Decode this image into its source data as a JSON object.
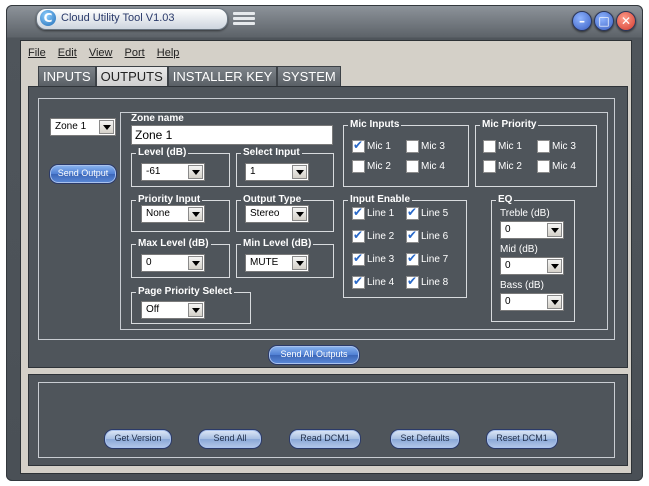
{
  "window": {
    "title": "Cloud Utility Tool V1.03",
    "logo_letter": "C",
    "menu_icon": "hamburger-icon",
    "controls": [
      {
        "name": "minimize-button",
        "icon": "minimize-icon",
        "color": "#3a5fc2"
      },
      {
        "name": "maximize-button",
        "icon": "maximize-icon",
        "color": "#3a5fc2"
      },
      {
        "name": "close-button",
        "icon": "close-icon",
        "color": "#d13a2e"
      }
    ]
  },
  "menu": [
    "File",
    "Edit",
    "View",
    "Port",
    "Help"
  ],
  "tabs": [
    {
      "label": "INPUTS",
      "active": false
    },
    {
      "label": "OUTPUTS",
      "active": true
    },
    {
      "label": "INSTALLER KEY",
      "active": false
    },
    {
      "label": "SYSTEM",
      "active": false
    }
  ],
  "zone_select": "Zone 1",
  "send_output_label": "Send Output",
  "zone_name": {
    "label": "Zone name",
    "value": "Zone 1"
  },
  "level": {
    "label": "Level (dB)",
    "value": "-61"
  },
  "select_input": {
    "label": "Select Input",
    "value": "1"
  },
  "priority_input": {
    "label": "Priority Input",
    "value": "None"
  },
  "output_type": {
    "label": "Output Type",
    "value": "Stereo"
  },
  "max_level": {
    "label": "Max Level (dB)",
    "value": "0"
  },
  "min_level": {
    "label": "Min Level (dB)",
    "value": "MUTE"
  },
  "page_priority": {
    "label": "Page Priority Select",
    "value": "Off"
  },
  "mic_inputs": {
    "label": "Mic Inputs",
    "items": [
      {
        "label": "Mic 1",
        "checked": true
      },
      {
        "label": "Mic 3",
        "checked": false
      },
      {
        "label": "Mic 2",
        "checked": false
      },
      {
        "label": "Mic 4",
        "checked": false
      }
    ]
  },
  "mic_priority": {
    "label": "Mic Priority",
    "items": [
      {
        "label": "Mic 1",
        "checked": false
      },
      {
        "label": "Mic 3",
        "checked": false
      },
      {
        "label": "Mic 2",
        "checked": false
      },
      {
        "label": "Mic 4",
        "checked": false
      }
    ]
  },
  "input_enable": {
    "label": "Input Enable",
    "items": [
      {
        "label": "Line 1",
        "checked": true
      },
      {
        "label": "Line 5",
        "checked": true
      },
      {
        "label": "Line 2",
        "checked": true
      },
      {
        "label": "Line 6",
        "checked": true
      },
      {
        "label": "Line 3",
        "checked": true
      },
      {
        "label": "Line 7",
        "checked": true
      },
      {
        "label": "Line 4",
        "checked": true
      },
      {
        "label": "Line 8",
        "checked": true
      }
    ]
  },
  "eq": {
    "label": "EQ",
    "treble": {
      "label": "Treble (dB)",
      "value": "0"
    },
    "mid": {
      "label": "Mid (dB)",
      "value": "0"
    },
    "bass": {
      "label": "Bass (dB)",
      "value": "0"
    }
  },
  "send_all_outputs_label": "Send All Outputs",
  "bottom_buttons": [
    "Get Version",
    "Send All",
    "Read DCM1",
    "Set Defaults",
    "Reset DCM1"
  ]
}
